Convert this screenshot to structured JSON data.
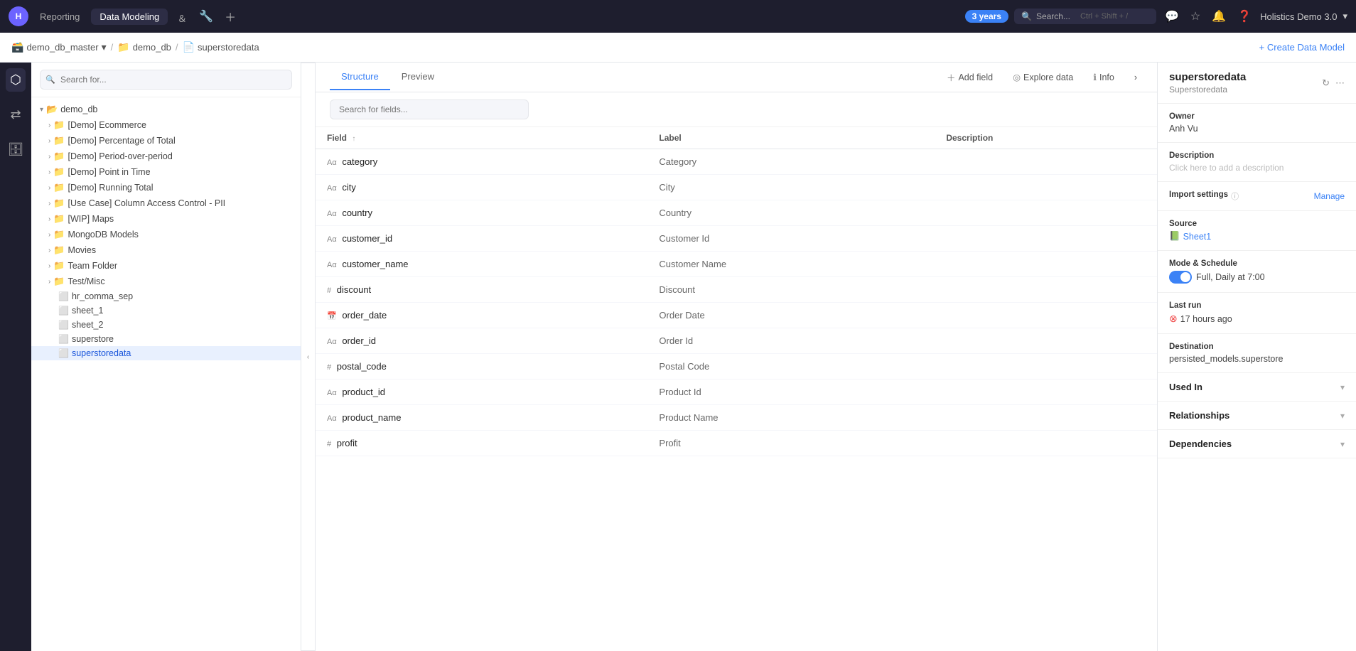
{
  "navbar": {
    "logo_text": "H",
    "links": [
      "Reporting",
      "Data Modeling"
    ],
    "active_link": "Data Modeling",
    "icons": [
      "terminal",
      "wrench",
      "plus"
    ],
    "years_badge": "3 years",
    "search_placeholder": "Search...",
    "search_shortcut": "Ctrl + Shift + /",
    "user_name": "Holistics Demo 3.0"
  },
  "breadcrumb": {
    "items": [
      {
        "icon": "🗃️",
        "text": "demo_db_master"
      },
      {
        "icon": "📁",
        "text": "demo_db"
      },
      {
        "icon": "📄",
        "text": "superstoredata"
      }
    ],
    "create_btn": "+ Create Data Model"
  },
  "tree": {
    "search_placeholder": "Search for...",
    "items": [
      {
        "label": "demo_db",
        "type": "folder",
        "indent": 0,
        "expanded": true
      },
      {
        "label": "[Demo] Ecommerce",
        "type": "folder",
        "indent": 1,
        "expanded": false
      },
      {
        "label": "[Demo] Percentage of Total",
        "type": "folder",
        "indent": 1,
        "expanded": false
      },
      {
        "label": "[Demo] Period-over-period",
        "type": "folder",
        "indent": 1,
        "expanded": false
      },
      {
        "label": "[Demo] Point in Time",
        "type": "folder",
        "indent": 1,
        "expanded": false
      },
      {
        "label": "[Demo] Running Total",
        "type": "folder",
        "indent": 1,
        "expanded": false
      },
      {
        "label": "[Use Case] Column Access Control - PII",
        "type": "folder",
        "indent": 1,
        "expanded": false
      },
      {
        "label": "[WIP] Maps",
        "type": "folder",
        "indent": 1,
        "expanded": false
      },
      {
        "label": "MongoDB Models",
        "type": "folder",
        "indent": 1,
        "expanded": false
      },
      {
        "label": "Movies",
        "type": "folder",
        "indent": 1,
        "expanded": false
      },
      {
        "label": "Team Folder",
        "type": "folder",
        "indent": 1,
        "expanded": false
      },
      {
        "label": "Test/Misc",
        "type": "folder",
        "indent": 1,
        "expanded": false
      },
      {
        "label": "hr_comma_sep",
        "type": "file",
        "indent": 1
      },
      {
        "label": "sheet_1",
        "type": "file",
        "indent": 1
      },
      {
        "label": "sheet_2",
        "type": "file",
        "indent": 1
      },
      {
        "label": "superstore",
        "type": "file",
        "indent": 1
      },
      {
        "label": "superstoredata",
        "type": "file",
        "indent": 1,
        "selected": true
      }
    ]
  },
  "tabs": {
    "items": [
      "Structure",
      "Preview"
    ],
    "active": "Structure",
    "actions": [
      {
        "icon": "+",
        "label": "Add field"
      },
      {
        "icon": "◎",
        "label": "Explore data"
      },
      {
        "icon": "ℹ",
        "label": "Info"
      }
    ]
  },
  "fields_search": {
    "placeholder": "Search for fields..."
  },
  "table": {
    "columns": [
      "Field",
      "Label",
      "Description"
    ],
    "rows": [
      {
        "type": "Aα",
        "field": "category",
        "label": "Category",
        "description": ""
      },
      {
        "type": "Aα",
        "field": "city",
        "label": "City",
        "description": ""
      },
      {
        "type": "Aα",
        "field": "country",
        "label": "Country",
        "description": ""
      },
      {
        "type": "Aα",
        "field": "customer_id",
        "label": "Customer Id",
        "description": ""
      },
      {
        "type": "Aα",
        "field": "customer_name",
        "label": "Customer Name",
        "description": ""
      },
      {
        "type": "#",
        "field": "discount",
        "label": "Discount",
        "description": ""
      },
      {
        "type": "📅",
        "field": "order_date",
        "label": "Order Date",
        "description": ""
      },
      {
        "type": "Aα",
        "field": "order_id",
        "label": "Order Id",
        "description": ""
      },
      {
        "type": "#",
        "field": "postal_code",
        "label": "Postal Code",
        "description": ""
      },
      {
        "type": "Aα",
        "field": "product_id",
        "label": "Product Id",
        "description": ""
      },
      {
        "type": "Aα",
        "field": "product_name",
        "label": "Product Name",
        "description": ""
      },
      {
        "type": "#",
        "field": "profit",
        "label": "Profit",
        "description": ""
      }
    ]
  },
  "right_panel": {
    "title": "superstoredata",
    "subtitle": "Superstoredata",
    "owner_label": "Owner",
    "owner_value": "Anh Vu",
    "description_label": "Description",
    "description_placeholder": "Click here to add a description",
    "import_settings_label": "Import settings",
    "manage_label": "Manage",
    "source_label": "Source",
    "source_link": "Sheet1",
    "mode_label": "Mode & Schedule",
    "mode_value": "Full, Daily at 7:00",
    "last_run_label": "Last run",
    "last_run_value": "17 hours ago",
    "destination_label": "Destination",
    "destination_value": "persisted_models.superstore",
    "used_in_label": "Used In",
    "relationships_label": "Relationships",
    "dependencies_label": "Dependencies"
  }
}
